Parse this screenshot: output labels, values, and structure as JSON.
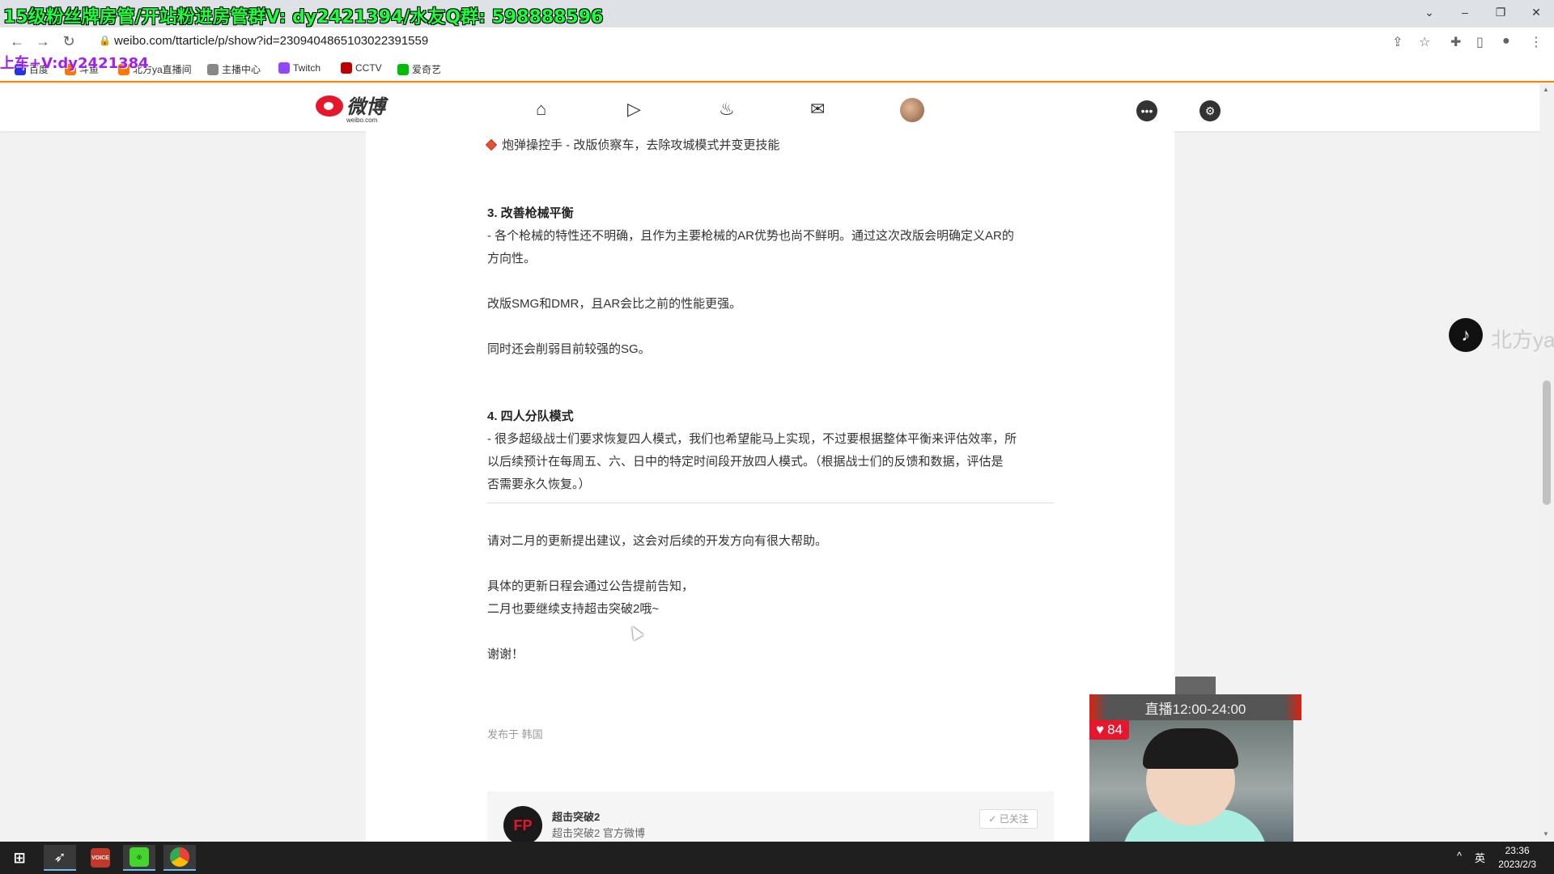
{
  "overlay": {
    "top_banner": "15级粉丝牌房管/开站粉进房管群V: dy2421394/水友Q群: 598888596",
    "side_note": "上车+V:dy2421384"
  },
  "browser": {
    "url": "weibo.com/ttarticle/p/show?id=2309404865103022391559",
    "bookmarks": [
      {
        "label": "百度",
        "color": "#2932e1"
      },
      {
        "label": "斗鱼",
        "color": "#ff7700"
      },
      {
        "label": "北方ya直播间",
        "color": "#ff7700"
      },
      {
        "label": "主播中心",
        "color": "#888888"
      },
      {
        "label": "Twitch",
        "color": "#9146ff"
      },
      {
        "label": "CCTV",
        "color": "#c00000"
      },
      {
        "label": "爱奇艺",
        "color": "#00be06"
      }
    ]
  },
  "weibo": {
    "logo_text": "微博",
    "logo_sub": "weibo.com",
    "nav_icons": [
      "home-icon",
      "video-icon",
      "hot-icon",
      "mail-icon"
    ],
    "accent": "#ff8200"
  },
  "article": {
    "bullet_line": "炮弹操控手 - 改版侦察车，去除攻城模式并变更技能",
    "sec3_title": "3. 改善枪械平衡",
    "sec3_p1a": "- 各个枪械的特性还不明确，且作为主要枪械的AR优势也尚不鲜明。通过这次改版会明确定义AR的",
    "sec3_p1b": "方向性。",
    "sec3_p2": "改版SMG和DMR，且AR会比之前的性能更强。",
    "sec3_p3": "同时还会削弱目前较强的SG。",
    "sec4_title": "4. 四人分队模式",
    "sec4_p1a": "- 很多超级战士们要求恢复四人模式，我们也希望能马上实现，不过要根据整体平衡来评估效率，所",
    "sec4_p1b": "以后续预计在每周五、六、日中的特定时间段开放四人模式。（根据战士们的反馈和数据，评估是",
    "sec4_p1c": "否需要永久恢复。）",
    "closing1": "请对二月的更新提出建议，这会对后续的开发方向有很大帮助。",
    "closing2": "具体的更新日程会通过公告提前告知，",
    "closing3": "二月也要继续支持超击突破2哦~",
    "thanks": "谢谢！",
    "published": "发布于 韩国",
    "author_name": "超击突破2",
    "author_desc": "超击突破2 官方微博",
    "follow_label": "已关注"
  },
  "stream": {
    "tiktok_name": "北方ya",
    "live_schedule": "直播12:00-24:00",
    "likes": "84"
  },
  "taskbar": {
    "apps": [
      "windows-start",
      "app-bird",
      "voicemeeter",
      "razer",
      "chrome"
    ],
    "ime": "英",
    "time": "23:36",
    "date": "2023/2/3"
  }
}
